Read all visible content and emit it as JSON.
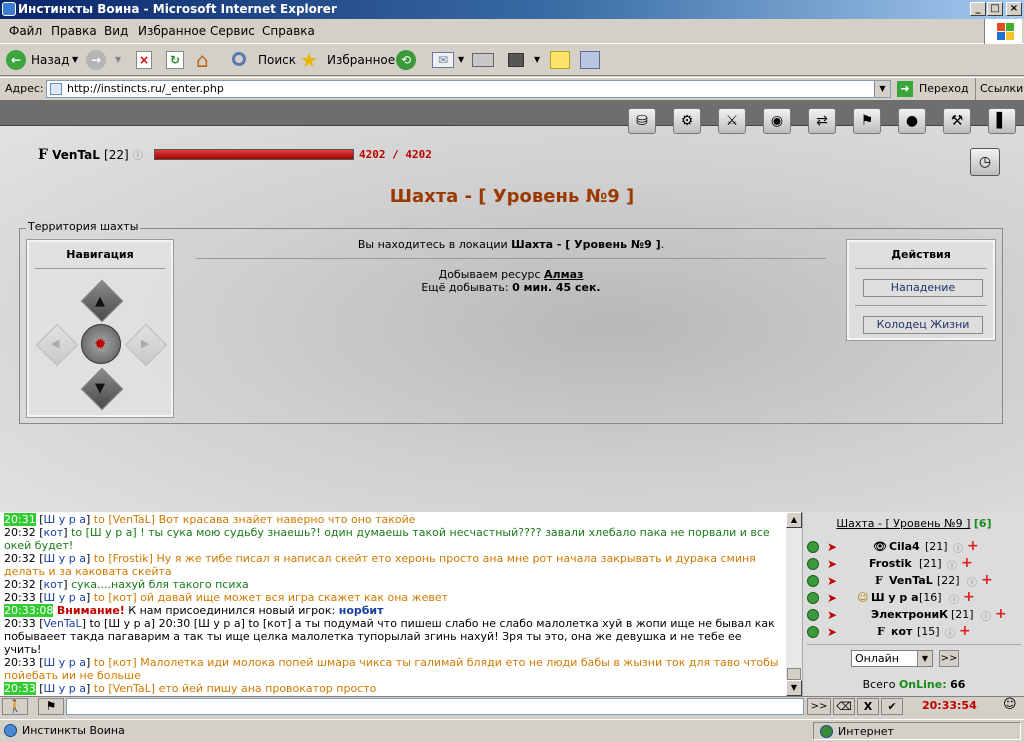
{
  "window": {
    "title": "Инстинкты Воина - Microsoft Internet Explorer",
    "min": "_",
    "max": "□",
    "close": "×"
  },
  "menu": [
    "Файл",
    "Правка",
    "Вид",
    "Избранное",
    "Сервис",
    "Справка"
  ],
  "toolbar": {
    "back": "Назад",
    "search": "Поиск",
    "favorites": "Избранное"
  },
  "address": {
    "label": "Адрес:",
    "url": "http://instincts.ru/_enter.php",
    "go": "Переход",
    "links": "Ссылки"
  },
  "player": {
    "clan_mark": "F",
    "name": "VenTaL",
    "level": "[22]",
    "hp_text": "4202 / 4202",
    "hp_fraction": 1.0
  },
  "location": {
    "title": "Шахта - [ Уровень №9 ]",
    "territory_label": "Территория шахты",
    "nav_title": "Навигация",
    "you_are_in_prefix": "Вы находитесь в локации",
    "you_are_in_place": "Шахта - [ Уровень №9 ]",
    "mining_prefix": "Добываем ресурс",
    "mining_resource": "Алмаз",
    "remaining_prefix": "Ещё добывать:",
    "remaining_time": "0 мин. 45 сек.",
    "actions_title": "Действия",
    "actions": [
      "Нападение",
      "Колодец Жизни"
    ]
  },
  "chat": [
    {
      "time": "20:31",
      "hl": true,
      "nick": "Ш у р а",
      "to": "to [VenTaL]",
      "text": "Вот красава знайет наверно что оно такойе",
      "color": "orange"
    },
    {
      "time": "20:32",
      "hl": false,
      "nick": "кот",
      "to": "to [Ш у р а]",
      "text": "! ты сука мою судьбу знаешь?! один думаешь такой несчастный???? завали хлебало пака не порвали и все окей будет!",
      "color": "green"
    },
    {
      "time": "20:32",
      "hl": false,
      "nick": "Ш у р а",
      "to": "to [Frostik]",
      "text": "Ну я же тибе писал я написал скейт ето херонь просто ана мне рот начала закрывать и дурака сминя делать и за каковата скейта",
      "color": "orange"
    },
    {
      "time": "20:32",
      "hl": false,
      "nick": "кот",
      "to": "",
      "text": "сука....нахуй бля такого психа",
      "color": "green"
    },
    {
      "time": "20:33",
      "hl": false,
      "nick": "Ш у р а",
      "to": "to [кот]",
      "text": "ой давай ище может вся игра скажет как она жевет",
      "color": "orange"
    },
    {
      "time": "20:33:08",
      "hl": true,
      "system": true,
      "warn": "Внимание!",
      "text": "К нам присоединился новый игрок:",
      "newbie": "норбит"
    },
    {
      "time": "20:33",
      "hl": false,
      "nick": "VenTaL",
      "to": "to [Ш у р а]",
      "text": "20:30 [Ш у р а] to [кот] а ты подумай что пишеш слабо не слабо малолетка хуй в жопи ище не бывал как побываеет такда пагаварим а так ты ище целка малолетка тупорылай згинь нахуй! Зря ты это, она же девушка и не тебе ее учить!",
      "color": "black"
    },
    {
      "time": "20:33",
      "hl": false,
      "nick": "Ш у р а",
      "to": "to [кот]",
      "text": "Малолетка иди молока попей шмара чикса ты галимай бляди ето не люди бабы в жызни ток для таво чтобы пойебать ии не больше",
      "color": "orange"
    },
    {
      "time": "20:33",
      "hl": true,
      "nick": "Ш у р а",
      "to": "to [VenTaL]",
      "text": "ето йей пишу ана провокатор просто",
      "color": "orange"
    }
  ],
  "users_panel": {
    "location_link": "Шахта - [ Уровень №9 ]",
    "count": "[6]",
    "users": [
      {
        "prefix": "👁",
        "name": "Cila4",
        "level": "[21]"
      },
      {
        "prefix": "",
        "name": "Frostik",
        "level": "[21]"
      },
      {
        "prefix": "F",
        "name": "VenTaL",
        "level": "[22]"
      },
      {
        "prefix": "☺",
        "name": "Ш у р а",
        "level": "[16]"
      },
      {
        "prefix": "",
        "name": "ЭлектрониК",
        "level": "[21]"
      },
      {
        "prefix": "F",
        "name": "кот",
        "level": "[15]"
      }
    ],
    "filter_selected": "Онлайн",
    "go": ">>",
    "total_label": "Всего",
    "online_label": "OnLine:",
    "online_count": "66"
  },
  "chat_input": {
    "value": "",
    "send": ">>",
    "clock": "20:33:54",
    "ok": "✔",
    "clear": "X"
  },
  "statusbar": {
    "page": "Инстинкты Воина",
    "zone": "Интернет"
  }
}
